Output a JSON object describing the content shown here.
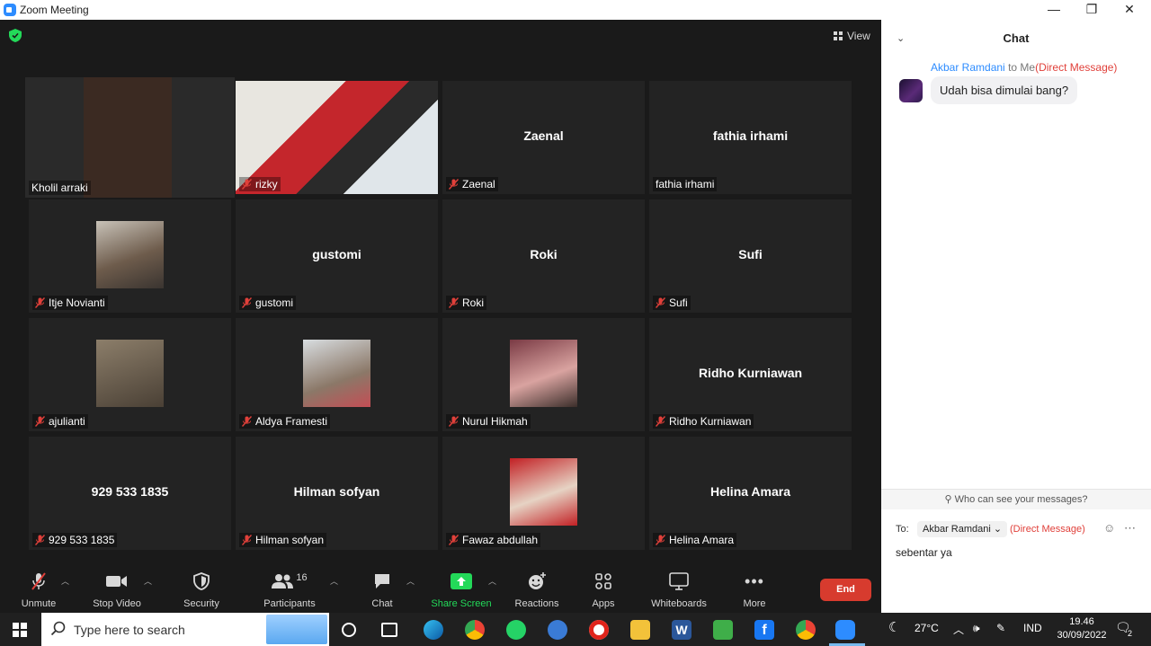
{
  "window": {
    "title": "Zoom Meeting",
    "min": "—",
    "max": "❐",
    "close": "✕"
  },
  "meeting": {
    "view_label": "View",
    "tiles": [
      {
        "name": "Kholil arraki",
        "display": "",
        "muted": false,
        "video": true,
        "active": true
      },
      {
        "name": "rizky",
        "display": "",
        "muted": true,
        "video": true,
        "active": false
      },
      {
        "name": "Zaenal",
        "display": "Zaenal",
        "muted": true,
        "video": false,
        "active": false
      },
      {
        "name": "fathia irhami",
        "display": "fathia irhami",
        "muted": false,
        "video": false,
        "active": false
      },
      {
        "name": "Itje Novianti",
        "display": "",
        "muted": true,
        "video": false,
        "photo": true,
        "active": false
      },
      {
        "name": "gustomi",
        "display": "gustomi",
        "muted": true,
        "video": false,
        "active": false
      },
      {
        "name": "Roki",
        "display": "Roki",
        "muted": true,
        "video": false,
        "active": false
      },
      {
        "name": "Sufi",
        "display": "Sufi",
        "muted": true,
        "video": false,
        "active": false
      },
      {
        "name": "ajulianti",
        "display": "",
        "muted": true,
        "video": false,
        "photo": true,
        "active": false
      },
      {
        "name": "Aldya Framesti",
        "display": "",
        "muted": true,
        "video": false,
        "photo": true,
        "active": false
      },
      {
        "name": "Nurul Hikmah",
        "display": "",
        "muted": true,
        "video": false,
        "photo": true,
        "active": false
      },
      {
        "name": "Ridho Kurniawan",
        "display": "Ridho Kurniawan",
        "muted": true,
        "video": false,
        "active": false
      },
      {
        "name": "929 533 1835",
        "display": "929 533 1835",
        "muted": true,
        "video": false,
        "active": false
      },
      {
        "name": "Hilman sofyan",
        "display": "Hilman sofyan",
        "muted": true,
        "video": false,
        "active": false
      },
      {
        "name": "Fawaz abdullah",
        "display": "",
        "muted": true,
        "video": false,
        "photo": true,
        "active": false
      },
      {
        "name": "Helina Amara",
        "display": "Helina Amara",
        "muted": true,
        "video": false,
        "active": false
      }
    ]
  },
  "toolbar": {
    "unmute": "Unmute",
    "stop_video": "Stop Video",
    "security": "Security",
    "participants": "Participants",
    "participants_count": "16",
    "chat": "Chat",
    "share_screen": "Share Screen",
    "reactions": "Reactions",
    "apps": "Apps",
    "whiteboards": "Whiteboards",
    "more": "More",
    "end": "End",
    "share_color": "#23d959",
    "end_color": "#d73b2e"
  },
  "chat": {
    "title": "Chat",
    "message": {
      "sender": "Akbar Ramdani",
      "to": "to Me",
      "dm": "(Direct Message)",
      "text": "Udah bisa dimulai bang?"
    },
    "who_can_see": "Who can see your messages?",
    "to_label": "To:",
    "recipient": "Akbar Ramdani",
    "dm_label": "(Direct Message)",
    "input_value": "sebentar ya"
  },
  "taskbar": {
    "search_placeholder": "Type here to search",
    "temperature": "27°C",
    "language": "IND",
    "time": "19.46",
    "date": "30/09/2022",
    "notifications": "2"
  }
}
